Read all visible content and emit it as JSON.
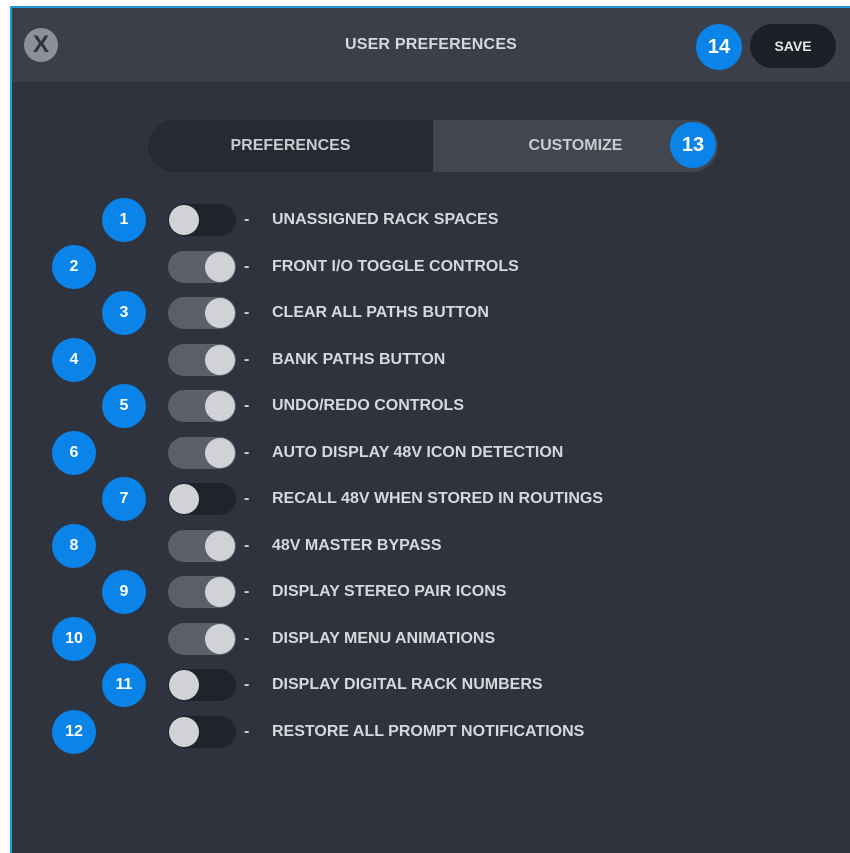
{
  "header": {
    "title": "USER PREFERENCES",
    "close_label": "X",
    "save_label": "SAVE",
    "badge": "14"
  },
  "tabs": {
    "items": [
      {
        "label": "PREFERENCES",
        "active": false
      },
      {
        "label": "CUSTOMIZE",
        "active": true
      }
    ],
    "badge": "13"
  },
  "settings": [
    {
      "badge": "1",
      "label": "UNASSIGNED RACK SPACES",
      "state": "off"
    },
    {
      "badge": "2",
      "label": "FRONT I/O TOGGLE CONTROLS",
      "state": "on"
    },
    {
      "badge": "3",
      "label": "CLEAR ALL PATHS BUTTON",
      "state": "on"
    },
    {
      "badge": "4",
      "label": "BANK PATHS BUTTON",
      "state": "on"
    },
    {
      "badge": "5",
      "label": "UNDO/REDO CONTROLS",
      "state": "on"
    },
    {
      "badge": "6",
      "label": "AUTO DISPLAY 48V ICON DETECTION",
      "state": "on"
    },
    {
      "badge": "7",
      "label": "RECALL 48V WHEN STORED IN ROUTINGS",
      "state": "off"
    },
    {
      "badge": "8",
      "label": "48V MASTER BYPASS",
      "state": "on"
    },
    {
      "badge": "9",
      "label": "DISPLAY STEREO PAIR ICONS",
      "state": "on"
    },
    {
      "badge": "10",
      "label": "DISPLAY MENU ANIMATIONS",
      "state": "on"
    },
    {
      "badge": "11",
      "label": "DISPLAY DIGITAL RACK NUMBERS",
      "state": "off"
    },
    {
      "badge": "12",
      "label": "RESTORE ALL PROMPT NOTIFICATIONS",
      "state": "off"
    }
  ],
  "separator": "-",
  "colors": {
    "accent": "#0a84e8",
    "panel": "#2f333e",
    "header": "#3a3f4a",
    "toggle_on": "#5b5f68",
    "toggle_off": "#1f232a"
  }
}
